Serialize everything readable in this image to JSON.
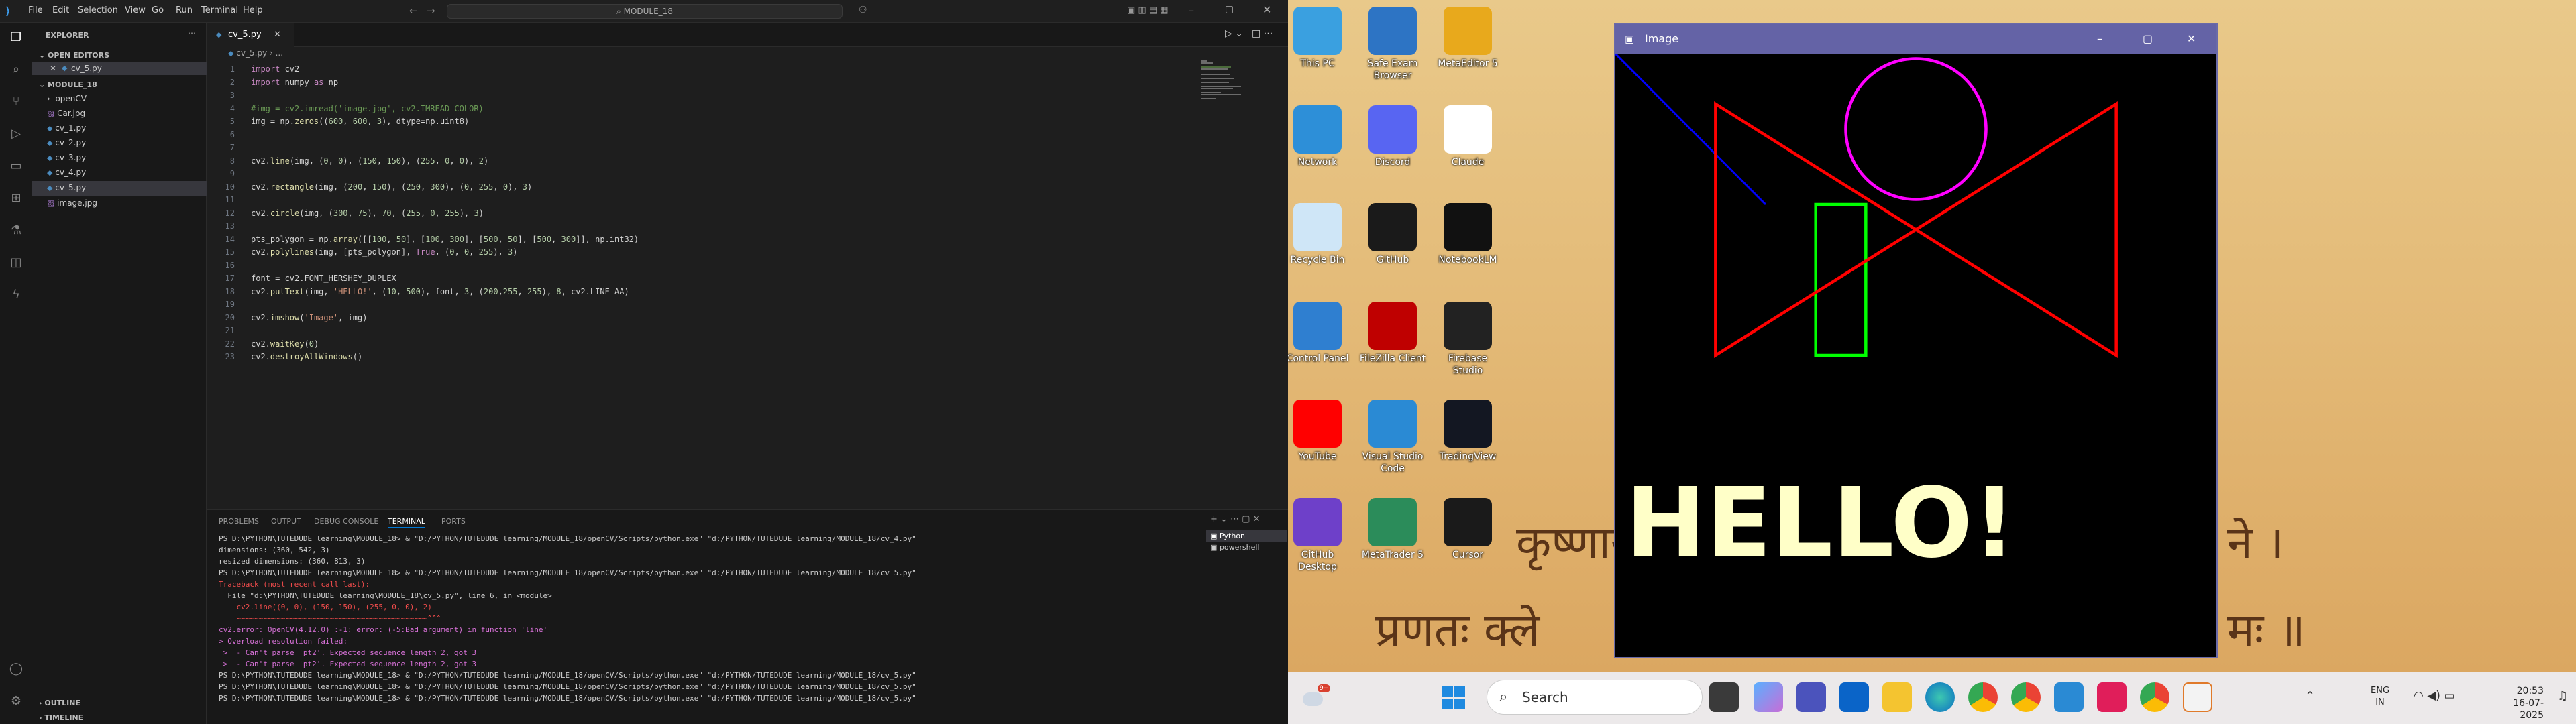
{
  "vscode": {
    "menu": [
      "File",
      "Edit",
      "Selection",
      "View",
      "Go",
      "Run",
      "Terminal",
      "Help"
    ],
    "search_text": "MODULE_18",
    "explorer_title": "EXPLORER",
    "open_editors": "OPEN EDITORS",
    "open_file": "cv_5.py",
    "folder": "MODULE_18",
    "files": [
      "openCV",
      "Car.jpg",
      "cv_1.py",
      "cv_2.py",
      "cv_3.py",
      "cv_4.py",
      "cv_5.py",
      "image.jpg"
    ],
    "outline": "OUTLINE",
    "timeline": "TIMELINE",
    "tab_label": "cv_5.py",
    "breadcrumb": "cv_5.py",
    "code_lines": [
      "import cv2",
      "import numpy as np",
      "",
      "#img = cv2.imread('image.jpg', cv2.IMREAD_COLOR)",
      "img = np.zeros((600, 600, 3), dtype=np.uint8)",
      "",
      "",
      "cv2.line(img, (0, 0), (150, 150), (255, 0, 0), 2)",
      "",
      "cv2.rectangle(img, (200, 150), (250, 300), (0, 255, 0), 3)",
      "",
      "cv2.circle(img, (300, 75), 70, (255, 0, 255), 3)",
      "",
      "pts_polygon = np.array([[100, 50], [100, 300], [500, 50], [500, 300]], np.int32)",
      "cv2.polylines(img, [pts_polygon], True, (0, 0, 255), 3)",
      "",
      "font = cv2.FONT_HERSHEY_DUPLEX",
      "cv2.putText(img, 'HELLO!', (10, 500), font, 3, (200,255, 255), 8, cv2.LINE_AA)",
      "",
      "cv2.imshow('Image', img)",
      "",
      "cv2.waitKey(0)",
      "cv2.destroyAllWindows()"
    ],
    "panel_tabs": [
      "PROBLEMS",
      "OUTPUT",
      "DEBUG CONSOLE",
      "TERMINAL",
      "PORTS"
    ],
    "terminal_lines": [
      "PS D:\\PYTHON\\TUTEDUDE learning\\MODULE_18> & \"D:/PYTHON/TUTEDUDE learning/MODULE_18/openCV/Scripts/python.exe\" \"d:/PYTHON/TUTEDUDE learning/MODULE_18/cv_4.py\"",
      "dimensions: (360, 542, 3)",
      "resized dimensions: (360, 813, 3)",
      "PS D:\\PYTHON\\TUTEDUDE learning\\MODULE_18> & \"D:/PYTHON/TUTEDUDE learning/MODULE_18/openCV/Scripts/python.exe\" \"d:/PYTHON/TUTEDUDE learning/MODULE_18/cv_5.py\"",
      "Traceback (most recent call last):",
      "  File \"d:\\PYTHON\\TUTEDUDE learning\\MODULE_18\\cv_5.py\", line 6, in <module>",
      "    cv2.line((0, 0), (150, 150), (255, 0, 0), 2)",
      "    ~~~~~~~~~~~~~~~~~~~~~~~~~~~~~~~~~~~~~~~~~~~^^^",
      "cv2.error: OpenCV(4.12.0) :-1: error: (-5:Bad argument) in function 'line'",
      "> Overload resolution failed:",
      " >  - Can't parse 'pt2'. Expected sequence length 2, got 3",
      " >  - Can't parse 'pt2'. Expected sequence length 2, got 3",
      "PS D:\\PYTHON\\TUTEDUDE learning\\MODULE_18> & \"D:/PYTHON/TUTEDUDE learning/MODULE_18/openCV/Scripts/python.exe\" \"d:/PYTHON/TUTEDUDE learning/MODULE_18/cv_5.py\"",
      "PS D:\\PYTHON\\TUTEDUDE learning\\MODULE_18> & \"D:/PYTHON/TUTEDUDE learning/MODULE_18/openCV/Scripts/python.exe\" \"d:/PYTHON/TUTEDUDE learning/MODULE_18/cv_5.py\"",
      "PS D:\\PYTHON\\TUTEDUDE learning\\MODULE_18> & \"D:/PYTHON/TUTEDUDE learning/MODULE_18/openCV/Scripts/python.exe\" \"d:/PYTHON/TUTEDUDE learning/MODULE_18/cv_5.py\""
    ],
    "terminal_list": [
      "Python",
      "powershell"
    ]
  },
  "desktop": {
    "icons": [
      {
        "label": "This PC",
        "color": "#3aa0e0"
      },
      {
        "label": "Safe Exam Browser",
        "color": "#2d74c4"
      },
      {
        "label": "MetaEditor 5",
        "color": "#e8a91c"
      },
      {
        "label": "Network",
        "color": "#2d8fd8"
      },
      {
        "label": "Discord",
        "color": "#5865f2"
      },
      {
        "label": "Claude",
        "color": "#ffffff"
      },
      {
        "label": "Recycle Bin",
        "color": "#cfe6f7"
      },
      {
        "label": "GitHub",
        "color": "#1a1a1a"
      },
      {
        "label": "NotebookLM",
        "color": "#111111"
      },
      {
        "label": "Control Panel",
        "color": "#2f7fd0"
      },
      {
        "label": "FileZilla Client",
        "color": "#bf0000"
      },
      {
        "label": "Firebase Studio",
        "color": "#222222"
      },
      {
        "label": "YouTube",
        "color": "#ff0000"
      },
      {
        "label": "Visual Studio Code",
        "color": "#2a8ad4"
      },
      {
        "label": "TradingView",
        "color": "#131722"
      },
      {
        "label": "GitHub Desktop",
        "color": "#6e40c9"
      },
      {
        "label": "MetaTrader 5",
        "color": "#2b8c5a"
      },
      {
        "label": "Cursor",
        "color": "#1a1a1a"
      }
    ],
    "wallpaper_line1": "कृष्णाय",
    "wallpaper_line1b": "ने ।",
    "wallpaper_line2": "प्रणतः क्ले",
    "wallpaper_line2b": "मः ॥",
    "image_window_title": "Image",
    "image_text": "HELLO!"
  },
  "taskbar": {
    "search_label": "Search",
    "lang": "ENG",
    "region": "IN",
    "time": "20:53",
    "date": "16-07-2025"
  }
}
